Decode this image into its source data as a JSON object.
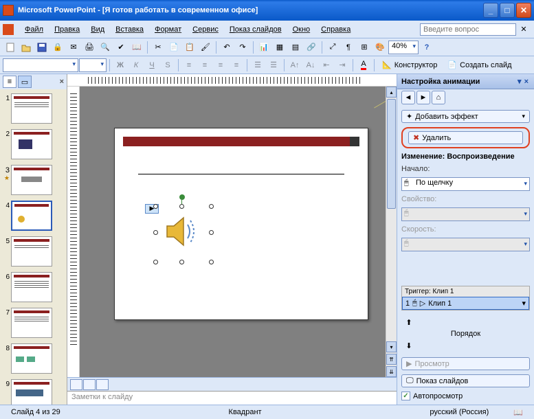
{
  "title": "Microsoft PowerPoint - [Я готов работать в современном офисе]",
  "menubar": {
    "items": [
      "Файл",
      "Правка",
      "Вид",
      "Вставка",
      "Формат",
      "Сервис",
      "Показ слайдов",
      "Окно",
      "Справка"
    ],
    "search_placeholder": "Введите вопрос"
  },
  "toolbar": {
    "zoom": "40%"
  },
  "formatbar": {
    "designer": "Конструктор",
    "newslide": "Создать слайд"
  },
  "thumbs": {
    "numbers": [
      "1",
      "2",
      "3",
      "4",
      "5",
      "6",
      "7",
      "8",
      "9"
    ],
    "selected": 4
  },
  "helpbubble": "?",
  "notes_placeholder": "Заметки к слайду",
  "taskpane": {
    "title": "Настройка анимации",
    "add_effect": "Добавить эффект",
    "remove": "Удалить",
    "change_section": "Изменение: Воспроизведение",
    "start_label": "Начало:",
    "start_value": "По щелчку",
    "property_label": "Свойство:",
    "speed_label": "Скорость:",
    "trigger_label": "Триггер: Клип 1",
    "trigger_item_num": "1",
    "trigger_item_name": "Клип 1",
    "reorder": "Порядок",
    "preview": "Просмотр",
    "slideshow": "Показ слайдов",
    "autopreview": "Автопросмотр"
  },
  "statusbar": {
    "slide": "Слайд 4 из 29",
    "template": "Квадрант",
    "lang": "русский (Россия)"
  }
}
